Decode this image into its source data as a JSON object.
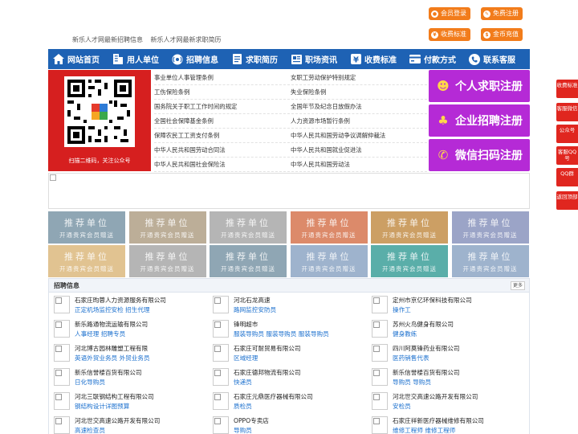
{
  "top_buttons": [
    {
      "label": "会员登录",
      "icon": "user-icon"
    },
    {
      "label": "免费注册",
      "icon": "pen-icon"
    },
    {
      "label": "收费标准",
      "icon": "yen-icon"
    },
    {
      "label": "金币充值",
      "icon": "coin-icon"
    }
  ],
  "latest": {
    "jobs": "新乐人才网最新招聘信息",
    "resumes": "新乐人才网最新求职简历"
  },
  "nav": [
    {
      "label": "网站首页",
      "icon": "home-icon"
    },
    {
      "label": "用人单位",
      "icon": "building-icon"
    },
    {
      "label": "招聘信息",
      "icon": "broadcast-icon"
    },
    {
      "label": "求职简历",
      "icon": "document-icon"
    },
    {
      "label": "职场资讯",
      "icon": "news-icon"
    },
    {
      "label": "收费标准",
      "icon": "yen-icon"
    },
    {
      "label": "付款方式",
      "icon": "payment-icon"
    },
    {
      "label": "联系客服",
      "icon": "phone-icon"
    }
  ],
  "qr_caption": "扫描二维码，关注公众号",
  "links": [
    [
      "事业单位人事管理条例",
      "女职工劳动保护特别规定"
    ],
    [
      "工伤保险条例",
      "失业保险条例"
    ],
    [
      "国务院关于职工工作时间的规定",
      "全国年节及纪念日放假办法"
    ],
    [
      "全国社会保障基金条例",
      "人力资源市场暂行条例"
    ],
    [
      "保障农民工工资支付条例",
      "中华人民共和国劳动争议调解仲裁法"
    ],
    [
      "中华人民共和国劳动合同法",
      "中华人民共和国就业促进法"
    ],
    [
      "中华人民共和国社会保险法",
      "中华人民共和国劳动法"
    ]
  ],
  "register": [
    {
      "label": "个人求职注册",
      "icon": "person-icon"
    },
    {
      "label": "企业招聘注册",
      "icon": "company-icon"
    },
    {
      "label": "微信扫码注册",
      "icon": "wechat-icon"
    }
  ],
  "ads": {
    "title": "推荐单位",
    "subtitle": "开通贵宾会员赠送",
    "colors": [
      "#8fa6b4",
      "#bcae98",
      "#b5b5b5",
      "#dc8a6a",
      "#cc9f64",
      "#9ba4c7",
      "#e1c391",
      "#b5b5b5",
      "#8fa6b4",
      "#9eb3cd",
      "#5aaea9",
      "#9eb3cd"
    ]
  },
  "jobs": {
    "title": "招聘信息",
    "more": "更多",
    "items": [
      {
        "company": "石家庄昀蓉人力资源服务有限公司",
        "positions": "正定机场监控安检 招生代理"
      },
      {
        "company": "河北石龙高速",
        "positions": "路网监控安防员"
      },
      {
        "company": "定州市京亿环保科技有限公司",
        "positions": "操作工"
      },
      {
        "company": "新乐路通物流运输有限公司",
        "positions": "人事经理 招聘专员"
      },
      {
        "company": "锋明超市",
        "positions": "服装导购员 服装导购员 服装导购员"
      },
      {
        "company": "苏州火鸟健身有限公司",
        "positions": "健身教练"
      },
      {
        "company": "河北博古园林雕塑工程有限",
        "positions": "英语外贸业务员 外贸业务员"
      },
      {
        "company": "石家庄可耐贸易有限公司",
        "positions": "区域经理"
      },
      {
        "company": "四川阿莫锋药业有限公司",
        "positions": "医药销售代表"
      },
      {
        "company": "新乐信誉楼百货有限公司",
        "positions": "日化导购员"
      },
      {
        "company": "石家庄德邦物流有限公司",
        "positions": "快递员"
      },
      {
        "company": "新乐信誉楼百货有限公司",
        "positions": "导购员 导购员"
      },
      {
        "company": "河北三联钢结构工程有限公司",
        "positions": "钢结构设计详图预算"
      },
      {
        "company": "石家庄元鼎医疗器械有限公司",
        "positions": "质检员"
      },
      {
        "company": "河北世交高速公路开发有限公司",
        "positions": "安检员"
      },
      {
        "company": "河北世交高速公路开发有限公司",
        "positions": "高速检查员"
      },
      {
        "company": "OPPO专卖店",
        "positions": "导购员"
      },
      {
        "company": "石家庄祥新医疗器械维修有限公司",
        "positions": "维修工程师 维修工程师"
      }
    ]
  },
  "side": [
    {
      "label": "收费标准"
    },
    {
      "label": "客服微信"
    },
    {
      "label": "公众号"
    },
    {
      "label": "客服QQ号"
    },
    {
      "label": "QQ群"
    },
    {
      "label": "返回顶部"
    }
  ]
}
